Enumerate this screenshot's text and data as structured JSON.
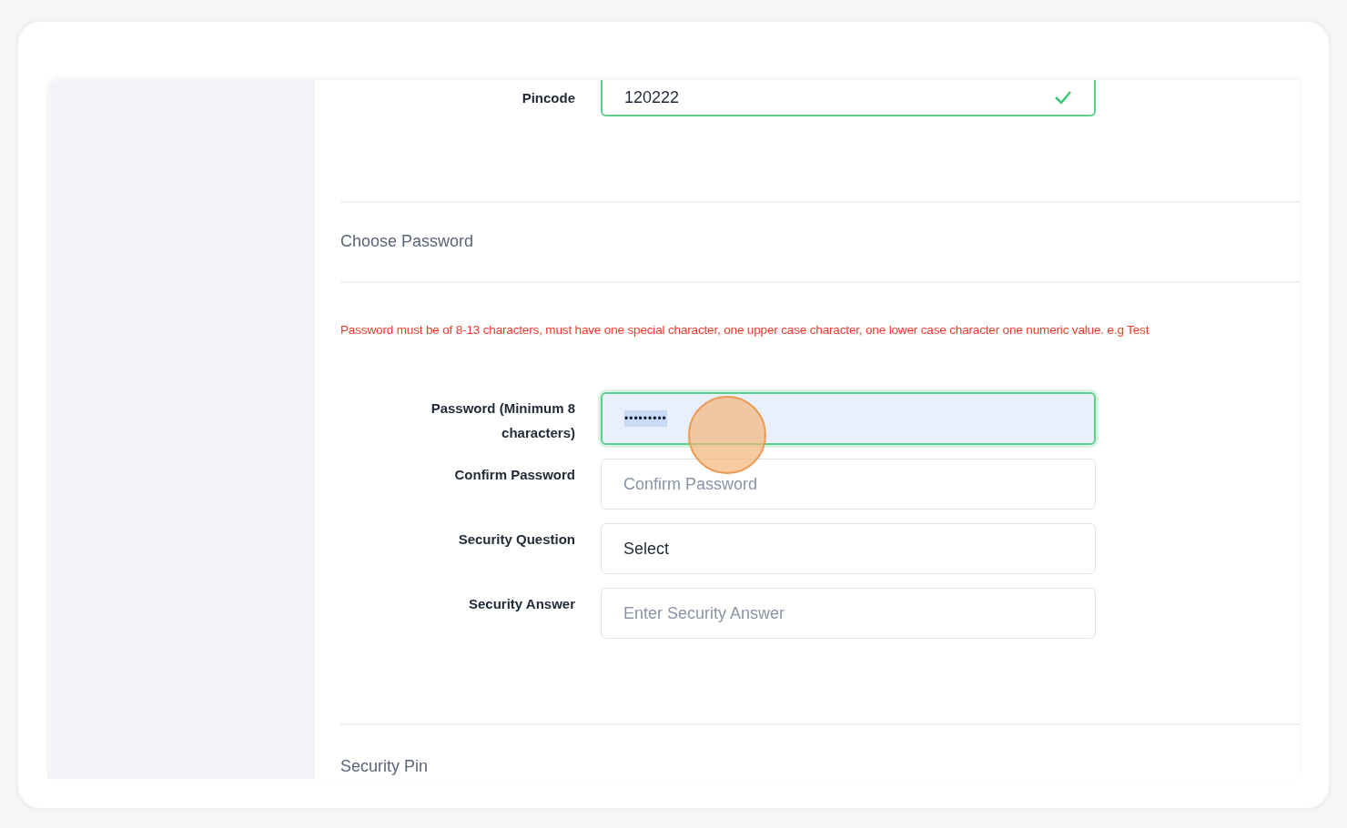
{
  "pincode": {
    "label": "Pincode",
    "value": "120222",
    "valid": true
  },
  "sections": [
    {
      "title": "Choose Password",
      "hint": "Password must be of 8-13 characters, must have one special character, one upper case character, one lower case character one numeric value. e.g Test",
      "fields": [
        {
          "label": "Password (Minimum 8 characters)",
          "kind": "password",
          "value": "•••••••••",
          "focused": true,
          "valid": true
        },
        {
          "label": "Confirm Password",
          "kind": "text",
          "placeholder": "Confirm Password",
          "focused": false,
          "valid": false
        },
        {
          "label": "Security Question",
          "kind": "select",
          "value": "Select",
          "focused": false,
          "valid": false
        },
        {
          "label": "Security Answer",
          "kind": "text",
          "placeholder": "Enter Security Answer",
          "focused": false,
          "valid": false
        }
      ]
    },
    {
      "title": "Security Pin"
    }
  ]
}
